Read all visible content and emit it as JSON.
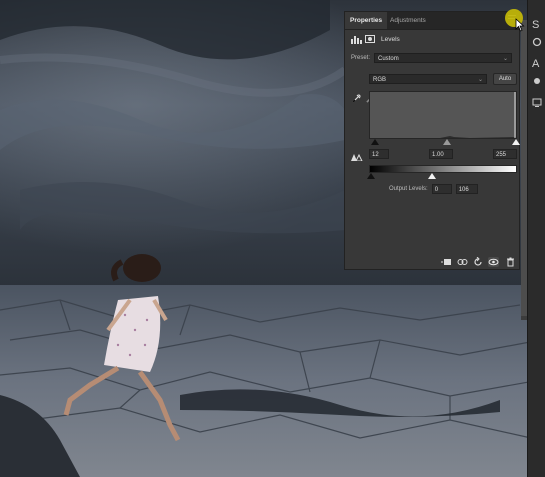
{
  "image": {
    "subject": "girl-leaping-over-cracked-ground-under-storm-clouds"
  },
  "panel": {
    "tabs": [
      {
        "label": "Properties"
      },
      {
        "label": "Adjustments"
      }
    ],
    "title": "Levels",
    "preset_label": "Preset:",
    "preset_value": "Custom",
    "channel_value": "RGB",
    "auto_label": "Auto",
    "input_levels": {
      "black": "12",
      "gamma": "1.00",
      "white": "255"
    },
    "output_label": "Output Levels:",
    "output_levels": {
      "low": "0",
      "high": "106"
    }
  },
  "icons": {
    "levels": "levels-icon",
    "mask": "layer-mask-icon",
    "droppers": [
      "black-point-eyedropper-icon",
      "gray-point-eyedropper-icon",
      "white-point-eyedropper-icon"
    ],
    "clipping_warning": "clipping-warning-icon",
    "bottom": [
      "clip-to-layer-icon",
      "view-previous-state-icon",
      "reset-icon",
      "visibility-eye-icon",
      "trash-icon"
    ]
  },
  "side_strip": {
    "glyphs": [
      "S",
      "A"
    ]
  },
  "colors": {
    "panel_bg": "#383838",
    "tab_bar": "#262626",
    "histogram_bg": "#555555",
    "cursor_highlight": "#c4ba08"
  }
}
